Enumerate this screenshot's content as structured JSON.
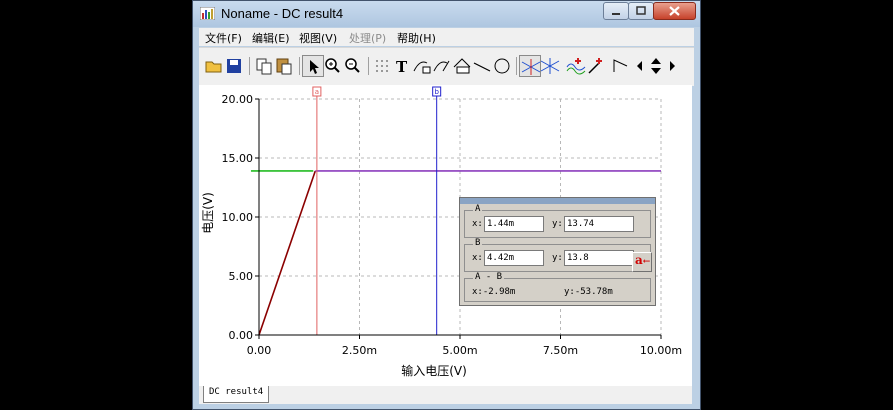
{
  "window": {
    "title": "Noname - DC result4",
    "app_icon": "bars-icon"
  },
  "menu": [
    {
      "label": "文件(F)",
      "enabled": true
    },
    {
      "label": "编辑(E)",
      "enabled": true
    },
    {
      "label": "视图(V)",
      "enabled": true
    },
    {
      "label": "处理(P)",
      "enabled": false
    },
    {
      "label": "帮助(H)",
      "enabled": true
    }
  ],
  "toolbar": {
    "icons": [
      "open-icon",
      "save-icon",
      "copy-icon",
      "paste-icon",
      "pointer-icon",
      "zoom-in-icon",
      "zoom-out-icon",
      "grid-icon",
      "text-icon",
      "label-icon",
      "arrow-label-icon",
      "data-label-icon",
      "line-icon",
      "ellipse-icon",
      "cursor-a-icon",
      "cursor-b-icon",
      "add-marker-icon",
      "marker-icon",
      "wave-icon",
      "scroll-left-icon",
      "scroll-updown-icon",
      "scroll-right-icon"
    ]
  },
  "chart_data": {
    "type": "line",
    "xlabel": "输入电压(V)",
    "ylabel": "电压(V)",
    "xlim": [
      0,
      10
    ],
    "ylim": [
      0,
      20
    ],
    "x_unit_suffix": "m",
    "x_ticks": [
      "0.00",
      "2.50m",
      "5.00m",
      "7.50m",
      "10.00m"
    ],
    "y_ticks": [
      "0.00",
      "5.00",
      "10.00",
      "15.00",
      "20.00"
    ],
    "x_tick_values": [
      0,
      2.5,
      5,
      7.5,
      10
    ],
    "y_tick_values": [
      0,
      5,
      10,
      15,
      20
    ],
    "grid": true,
    "series": [
      {
        "color": "#8b0000",
        "x": [
          0,
          1.4
        ],
        "y": [
          0,
          13.9
        ]
      },
      {
        "color": "#8b3dbd",
        "x": [
          1.4,
          10
        ],
        "y": [
          13.9,
          13.9
        ]
      },
      {
        "color": "#22bb22",
        "x": [
          -0.2,
          1.35
        ],
        "y": [
          13.9,
          13.9
        ]
      }
    ],
    "cursors": [
      {
        "name": "a",
        "x": 1.44,
        "color": "#e06060"
      },
      {
        "name": "b",
        "x": 4.42,
        "color": "#2020cc"
      }
    ]
  },
  "cursor_panel": {
    "groups": [
      {
        "label": "A",
        "x_label": "x:",
        "x_value": "1.44m",
        "y_label": "y:",
        "y_value": "13.74"
      },
      {
        "label": "B",
        "x_label": "x:",
        "x_value": "4.42m",
        "y_label": "y:",
        "y_value": "13.8"
      }
    ],
    "diff": {
      "label": "A - B",
      "x_text": "x:-2.98m",
      "y_text": "y:-53.78m"
    },
    "swap_label": "a"
  },
  "status": {
    "tab": "DC result4"
  }
}
